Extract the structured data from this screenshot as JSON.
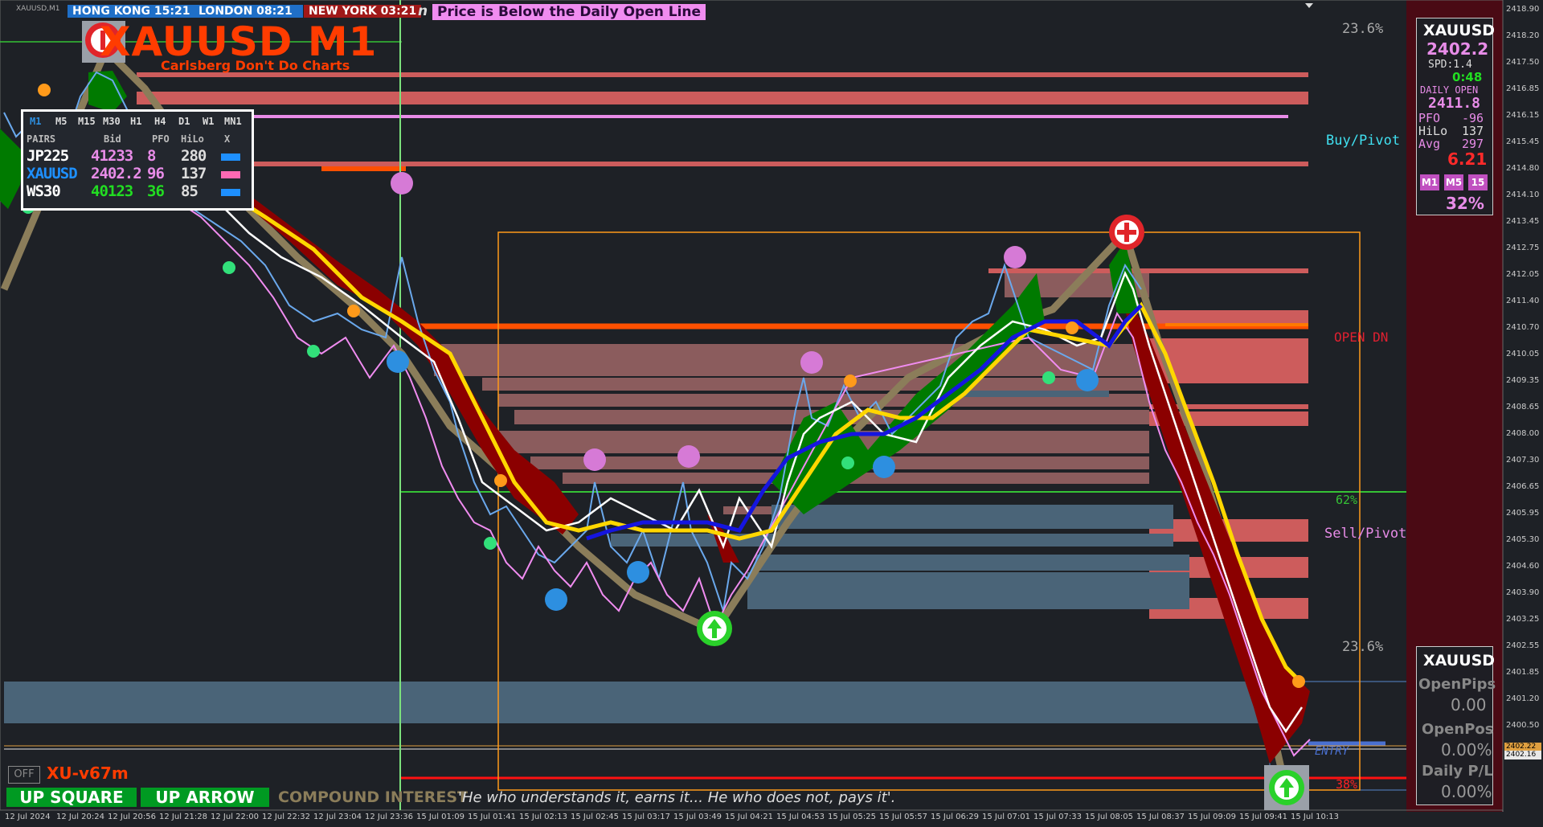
{
  "window": {
    "tab_label": "XAUUSD,M1"
  },
  "clocks": [
    {
      "label": "HONG KONG 15:21",
      "bg": "#1f6fc7"
    },
    {
      "label": "LONDON  08:21",
      "bg": "#1f6fc7"
    },
    {
      "label": "NEW YORK  03:21",
      "bg": "#a01818"
    }
  ],
  "clock_suffix": "n",
  "banner": "Price is Below the Daily Open Line",
  "title": "XAUUSD M1",
  "subtitle": "Carlsberg Don't Do Charts",
  "pairs_panel": {
    "timeframes": [
      "M1",
      "M5",
      "M15",
      "M30",
      "H1",
      "H4",
      "D1",
      "W1",
      "MN1"
    ],
    "headers": [
      "PAIRS",
      "Bid",
      "PFO",
      "HiLo",
      "X"
    ],
    "rows": [
      {
        "pair": "JP225",
        "bid": "41233",
        "pfo": "8",
        "hilo": "280",
        "pair_color": "#ffffff",
        "bid_color": "#e88ce8",
        "pfo_color": "#e88ce8",
        "x_color": "#1e90ff"
      },
      {
        "pair": "XAUUSD",
        "bid": "2402.2",
        "pfo": "96",
        "hilo": "137",
        "pair_color": "#1e90ff",
        "bid_color": "#e88ce8",
        "pfo_color": "#e88ce8",
        "x_color": "#ff69b4"
      },
      {
        "pair": "WS30",
        "bid": "40123",
        "pfo": "36",
        "hilo": "85",
        "pair_color": "#ffffff",
        "bid_color": "#22dd22",
        "pfo_color": "#22dd22",
        "x_color": "#1e90ff"
      }
    ]
  },
  "level_labels": {
    "fib_top": "23.6%",
    "buy_pivot": "Buy/Pivot",
    "open_dn": "OPEN DN",
    "fib_62": "62%",
    "sell_pivot": "Sell/Pivot",
    "fib_bottom": "23.6%",
    "fib_38": "38%",
    "entry": "ENTRY"
  },
  "info_panel": {
    "symbol": "XAUUSD",
    "price": "2402.2",
    "spread": "SPD:1.4",
    "timer": "0:48",
    "daily_open_label": "DAILY OPEN",
    "daily_open_value": "2411.8",
    "pfo_label": "PFO",
    "pfo_value": "-96",
    "hilo_label": "HiLo",
    "hilo_value": "137",
    "avg_label": "Avg",
    "avg_value": "297",
    "adr_value": "6.21",
    "tf_buttons": [
      "M1",
      "M5",
      "15"
    ],
    "percent": "32%"
  },
  "position_panel": {
    "symbol": "XAUUSD",
    "open_pips_label": "OpenPips",
    "open_pips_value": "0.00",
    "open_pos_label": "OpenPos",
    "open_pos_value": "0.00%",
    "daily_pl_label": "Daily P/L",
    "daily_pl_value": "0.00%"
  },
  "price_axis": [
    "2418.90",
    "2418.20",
    "2417.50",
    "2416.85",
    "2416.15",
    "2415.45",
    "2414.80",
    "2414.10",
    "2413.45",
    "2412.75",
    "2412.05",
    "2411.40",
    "2410.70",
    "2410.05",
    "2409.35",
    "2408.65",
    "2408.00",
    "2407.30",
    "2406.65",
    "2405.95",
    "2405.30",
    "2404.60",
    "2403.90",
    "2403.25",
    "2402.55",
    "2401.85",
    "2401.20",
    "2400.50"
  ],
  "price_markers": {
    "bid": "2402.22",
    "ask": "2402.16"
  },
  "time_axis": [
    "12 Jul 2024",
    "12 Jul 20:24",
    "12 Jul 20:56",
    "12 Jul 21:28",
    "12 Jul 22:00",
    "12 Jul 22:32",
    "12 Jul 23:04",
    "12 Jul 23:36",
    "15 Jul 01:09",
    "15 Jul 01:41",
    "15 Jul 02:13",
    "15 Jul 02:45",
    "15 Jul 03:17",
    "15 Jul 03:49",
    "15 Jul 04:21",
    "15 Jul 04:53",
    "15 Jul 05:25",
    "15 Jul 05:57",
    "15 Jul 06:29",
    "15 Jul 07:01",
    "15 Jul 07:33",
    "15 Jul 08:05",
    "15 Jul 08:37",
    "15 Jul 09:09",
    "15 Jul 09:41",
    "15 Jul 10:13"
  ],
  "bottom_bar": {
    "toggle": "OFF",
    "version": "XU-v67m",
    "up_square": "UP SQUARE",
    "up_arrow": "UP ARROW",
    "compound": "COMPOUND INTEREST",
    "quote": "'He who understands it, earns it... He who does not, pays it'."
  },
  "colors": {
    "bg": "#1e2126",
    "side_panel": "#4a0a14",
    "resistance_zone": "#cd5c5c",
    "support_zone": "#4a6478",
    "zigzag": "#8b7d5a",
    "ema_fast": "#ffd700",
    "ema_slow": "#0000ff",
    "bear_fill": "#8b0000",
    "bull_fill": "#007a00"
  }
}
